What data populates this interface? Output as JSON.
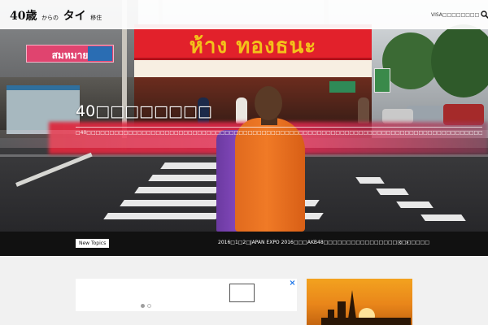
{
  "header": {
    "logo_main": "40歳",
    "logo_from": "からの",
    "logo_thai": "タイ",
    "logo_resident": "移住",
    "search_label": "VISA□□□□□□□□",
    "search_icon": "search-icon"
  },
  "hero": {
    "title": "40□□□□□□□□",
    "subtitle": "□40□□□□□□□□□□□□□□□□□□□□□□□□□□□□□□□□□□□□□□□□□□□□□□□□□□□□□□□□□□□□□□□□□□□□□□□□□□□□□□□□□□□□□□□",
    "sign_red_text": "ห้าง ทองธนะ",
    "sign_pink_text": "สมหมาย"
  },
  "ticker": {
    "badge": "New Topics",
    "text": "2016□1□2□JAPAN EXPO 2016□□□AKB48□□□□□□□□□□□□□□□□□□□□□□□",
    "prev_label": "‹",
    "next_label": "›"
  },
  "colors": {
    "sign_red": "#e2212b",
    "sign_yellow_text": "#f3c21a",
    "robe_orange": "#f07a26",
    "sash_purple": "#8a4cc4",
    "ticker_bg": "#111111",
    "content_bg": "#f1f1f1"
  }
}
